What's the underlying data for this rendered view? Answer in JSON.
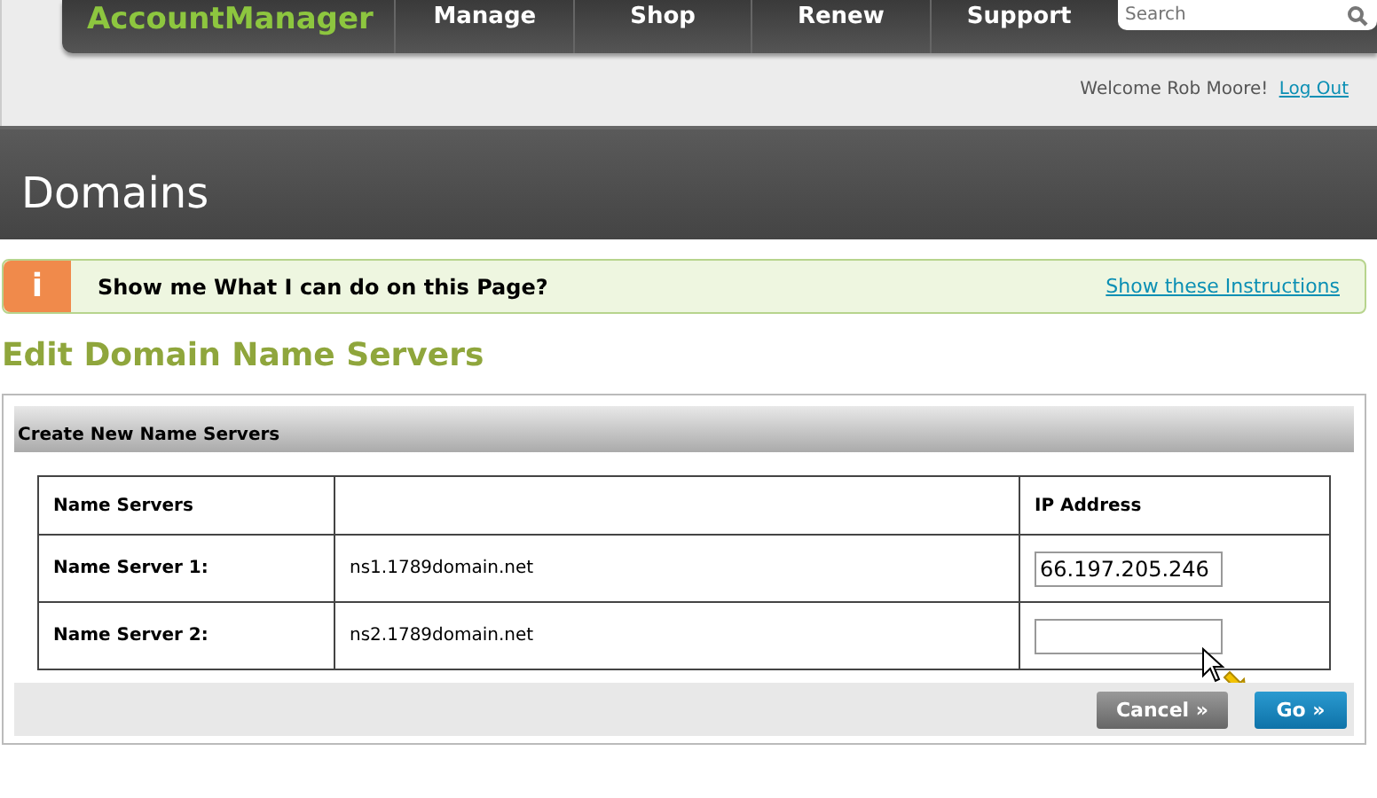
{
  "header": {
    "logo": "AccountManager",
    "nav": [
      {
        "label": "Manage"
      },
      {
        "label": "Shop"
      },
      {
        "label": "Renew"
      },
      {
        "label": "Support"
      }
    ],
    "search": {
      "placeholder": "Search"
    },
    "welcome": "Welcome Rob Moore!",
    "logout": "Log Out"
  },
  "banner": {
    "title": "Domains"
  },
  "instructions": {
    "icon": "i",
    "text": "Show me What I can do on this Page?",
    "link": "Show these Instructions"
  },
  "page_title": "Edit Domain Name Servers",
  "panel": {
    "title": "Create New Name Servers",
    "columns": [
      "Name Servers",
      "IP Address"
    ],
    "rows": [
      {
        "label": "Name Server 1:",
        "host": "ns1.1789domain.net",
        "ip": "66.197.205.246"
      },
      {
        "label": "Name Server 2:",
        "host": "ns2.1789domain.net",
        "ip": ""
      }
    ],
    "buttons": [
      {
        "label": "Cancel »",
        "kind": "secondary"
      },
      {
        "label": "Go »",
        "kind": "primary"
      }
    ]
  }
}
